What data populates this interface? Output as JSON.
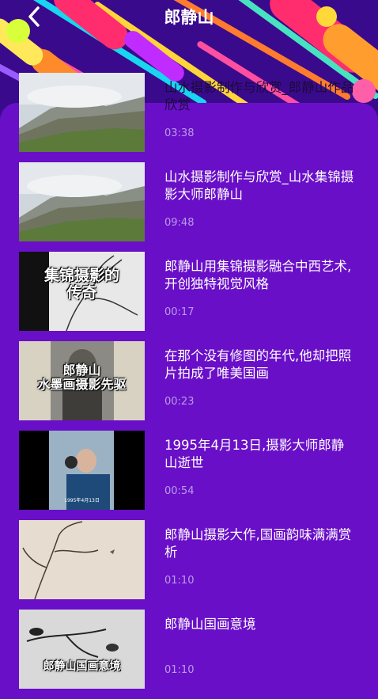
{
  "header": {
    "title": "郎静山"
  },
  "items": [
    {
      "title": "山水摄影制作与欣赏_郎静山作品欣赏",
      "duration": "03:38",
      "thumb": "mountain"
    },
    {
      "title": "山水摄影制作与欣赏_山水集锦摄影大师郎静山",
      "duration": "09:48",
      "thumb": "mountain"
    },
    {
      "title": "郎静山用集锦摄影融合中西艺术,开创独特视觉风格",
      "duration": "00:17",
      "thumb": "branch",
      "caption": "集锦摄影的\n传奇"
    },
    {
      "title": "在那个没有修图的年代,他却把照片拍成了唯美国画",
      "duration": "00:23",
      "thumb": "portrait",
      "caption": "郎静山\n水墨画摄影先驱"
    },
    {
      "title": "1995年4月13日,摄影大师郎静山逝世",
      "duration": "00:54",
      "thumb": "photo",
      "caption": "1995年4月13日"
    },
    {
      "title": "郎静山摄影大作,国画韵味满满赏析",
      "duration": "01:10",
      "thumb": "tree"
    },
    {
      "title": "郎静山国画意境",
      "duration": "01:10",
      "thumb": "bird",
      "caption": "郎静山国画意境"
    }
  ]
}
